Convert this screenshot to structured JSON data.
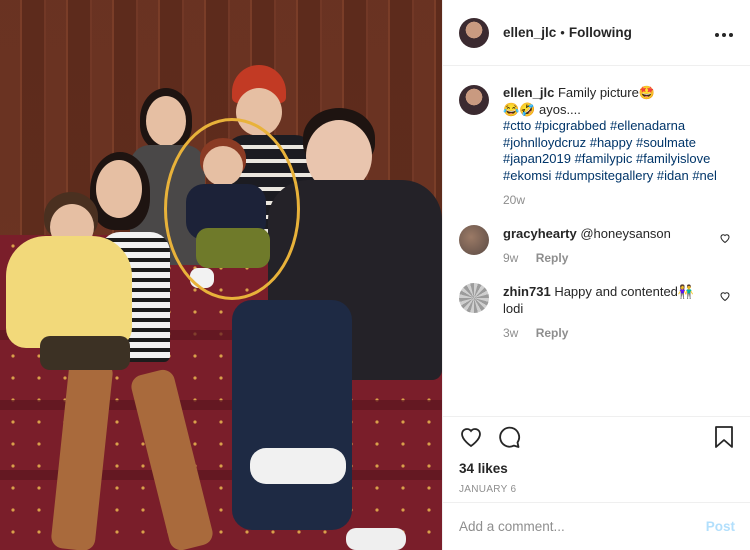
{
  "post": {
    "username": "ellen_jlc",
    "separator": "•",
    "follow_status": "Following",
    "more_label": "•••",
    "caption": {
      "username": "ellen_jlc",
      "text": "Family picture🤩",
      "line2": "😂🤣 ayos....",
      "hashtags": "#ctto #picgrabbed #ellenadarna #johnlloydcruz #happy #soulmate #japan2019 #familypic #familyislove #ekomsi #dumpsitegallery #idan #nel",
      "age": "20w"
    },
    "comments": [
      {
        "username": "gracyhearty",
        "text": "@honeysanson",
        "age": "9w",
        "reply": "Reply"
      },
      {
        "username": "zhin731",
        "text": "Happy and contented👫 lodi",
        "age": "3w",
        "reply": "Reply"
      }
    ],
    "likes": "34 likes",
    "date": "JANUARY 6",
    "add_comment_placeholder": "Add a comment...",
    "post_button": "Post"
  },
  "colors": {
    "hashtag": "#003569",
    "post_disabled": "#b2dffc",
    "highlight": "#e8b23a"
  },
  "icons": [
    "more-options-icon",
    "heart-icon",
    "comment-icon",
    "bookmark-icon",
    "small-heart-icon"
  ]
}
